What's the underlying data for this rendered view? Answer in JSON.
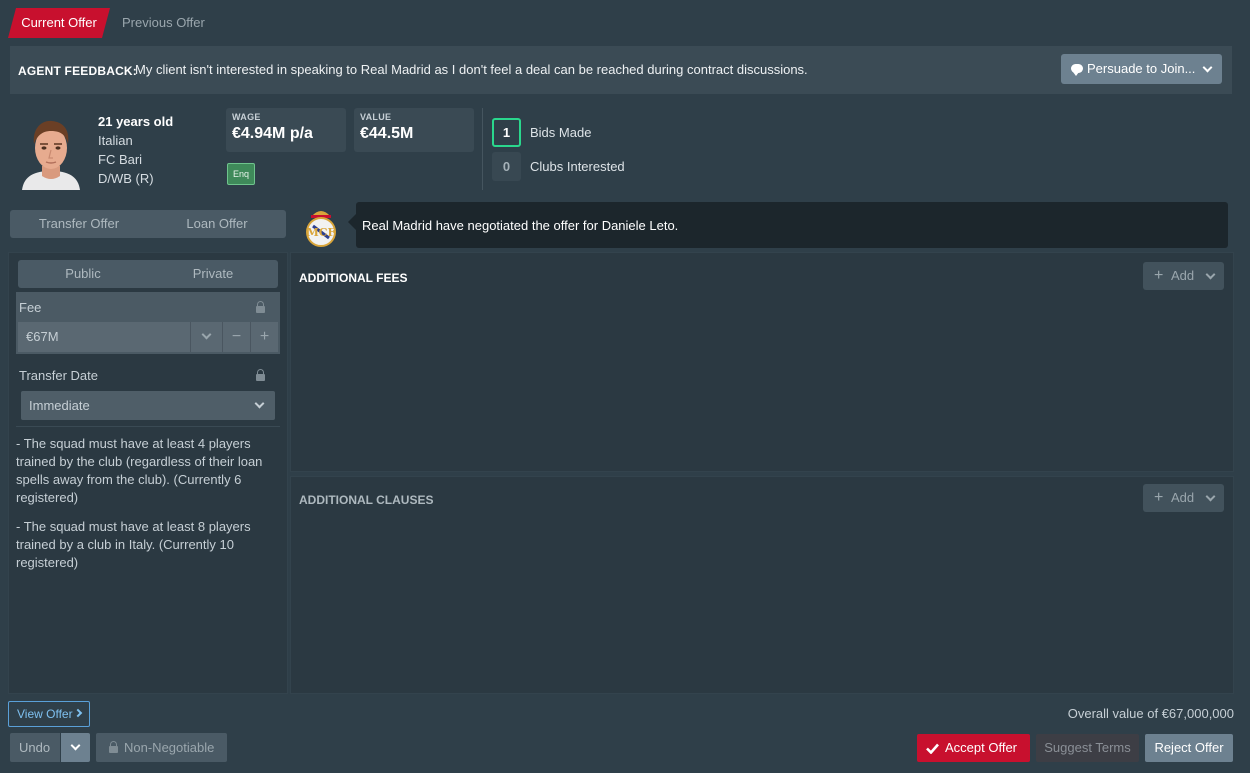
{
  "tabs": {
    "current": "Current Offer",
    "previous": "Previous Offer"
  },
  "feedback": {
    "label": "AGENT FEEDBACK:",
    "message": "My client isn't interested in speaking to Real Madrid as I don't feel a deal can be reached during contract discussions.",
    "persuade_label": "Persuade to Join..."
  },
  "player": {
    "age": "21 years old",
    "nationality": "Italian",
    "club": "FC Bari",
    "position": "D/WB (R)"
  },
  "wage": {
    "title": "WAGE",
    "value": "€4.94M p/a"
  },
  "value": {
    "title": "VALUE",
    "value": "€44.5M"
  },
  "enq_badge": "Enq",
  "bids": {
    "count": "1",
    "label": "Bids Made"
  },
  "clubs": {
    "count": "0",
    "label": "Clubs Interested"
  },
  "offer_types": {
    "transfer": "Transfer Offer",
    "loan": "Loan Offer"
  },
  "news": "Real Madrid have negotiated the offer for Daniele Leto.",
  "visibility": {
    "public": "Public",
    "private": "Private"
  },
  "fee": {
    "label": "Fee",
    "value": "€67M"
  },
  "transfer_date": {
    "label": "Transfer Date",
    "value": "Immediate"
  },
  "rules": [
    "- The squad must have at least 4 players trained by the club (regardless of their loan spells away from the club). (Currently 6 registered)",
    "- The squad must have at least 8 players trained by a club in Italy. (Currently 10 registered)"
  ],
  "additional_fees": {
    "title": "ADDITIONAL FEES",
    "add_label": "Add"
  },
  "additional_clauses": {
    "title": "ADDITIONAL CLAUSES",
    "add_label": "Add"
  },
  "footer": {
    "view_offer": "View Offer",
    "overall_value": "Overall value of €67,000,000",
    "undo": "Undo",
    "non_negotiable": "Non-Negotiable",
    "accept": "Accept Offer",
    "suggest": "Suggest Terms",
    "reject": "Reject Offer"
  },
  "colors": {
    "accent_red": "#c8102e",
    "success_green": "#2ad78d",
    "background": "#2f3f49"
  }
}
